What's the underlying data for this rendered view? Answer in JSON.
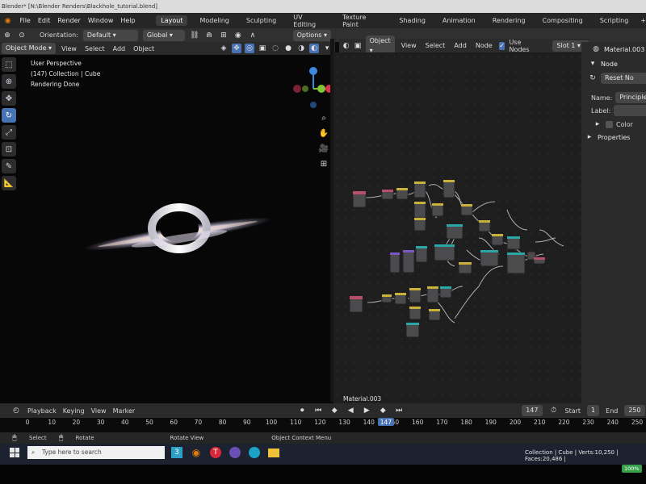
{
  "window_title": "Blender* [N:\\Blender Renders\\Blackhole_tutorial.blend]",
  "menubar": {
    "items": [
      "File",
      "Edit",
      "Render",
      "Window",
      "Help"
    ],
    "workspaces": [
      "Layout",
      "Modeling",
      "Sculpting",
      "UV Editing",
      "Texture Paint",
      "Shading",
      "Animation",
      "Rendering",
      "Compositing",
      "Scripting"
    ],
    "active_workspace": "Layout",
    "add_tab": "+"
  },
  "toolbar": {
    "orientation_label": "Orientation:",
    "orientation_value": "Default",
    "transform_space": "Global",
    "options": "Options"
  },
  "viewport": {
    "mode": "Object Mode",
    "menus": [
      "View",
      "Select",
      "Add",
      "Object"
    ],
    "info_lines": [
      "User Perspective",
      "(147) Collection | Cube",
      "Rendering Done"
    ],
    "gizmo_axes": {
      "x": "X",
      "y": "Y",
      "z": "Z"
    }
  },
  "node_editor": {
    "mode": "Object",
    "menus": [
      "View",
      "Select",
      "Add",
      "Node"
    ],
    "use_nodes_label": "Use Nodes",
    "use_nodes_checked": true,
    "slot": "Slot 1",
    "material_name": "Material.003"
  },
  "properties": {
    "material": "Material.003",
    "tab_node": "Node",
    "reset_button": "Reset No",
    "name_label": "Name:",
    "name_value": "Principled",
    "label_label": "Label:",
    "color_section": "Color",
    "properties_section": "Properties"
  },
  "timeline": {
    "menus": [
      "Playback",
      "Keying",
      "View",
      "Marker"
    ],
    "frame_ticks": [
      0,
      10,
      20,
      30,
      40,
      50,
      60,
      70,
      80,
      90,
      100,
      110,
      120,
      130,
      140,
      150,
      160,
      170,
      180,
      190,
      200,
      210,
      220,
      230,
      240,
      250
    ],
    "current_frame": "147",
    "current_frame_field": "147",
    "start_label": "Start",
    "start_value": "1",
    "end_label": "End",
    "end_value": "250"
  },
  "statusbar": {
    "select": "Select",
    "rotate": "Rotate",
    "rotate_view": "Rotate View",
    "context_menu": "Object Context Menu",
    "scene_stats": "Collection | Cube | Verts:10,250 | Faces:20,486 |"
  },
  "taskbar": {
    "search_placeholder": "Type here to search",
    "percent": "100%"
  },
  "colors": {
    "accent": "#4772b3",
    "x_axis": "#e0314a",
    "y_axis": "#82c338",
    "z_axis": "#3b8ae0",
    "node_header_teal": "#2aa7a5",
    "node_header_yellow": "#c9b237",
    "node_header_pink": "#b64f6a",
    "node_header_purple": "#7a56c6"
  }
}
